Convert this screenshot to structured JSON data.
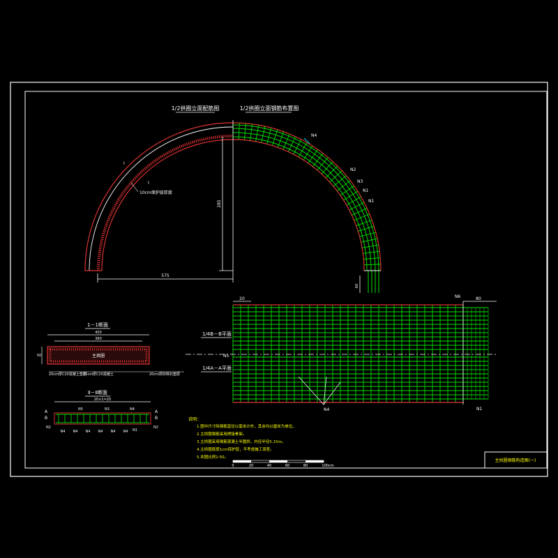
{
  "titles": {
    "left_half": "1/2拱圈立面配筋图",
    "right_half": "1/2拱圈立面钢筋布置图",
    "sec_1": "1－1断面",
    "sec_2": "Ⅱ－Ⅱ断面",
    "plan_b": "1/4B－B平面",
    "plan_a": "1/4A－A平面"
  },
  "labels": {
    "layer_10cm": "10cm保护层厚度",
    "n1": "N1",
    "n2": "N2",
    "n3": "N3",
    "n4": "N4",
    "n5": "N5",
    "n6": "N6",
    "a": "A",
    "b": "B",
    "i": "I",
    "sec1_center": "主拱圈",
    "sec1_bottom_left": "20cm厚C20混凝土垫层",
    "sec1_bottom_mid": "15cm厚C25混凝土",
    "sec1_bottom_right": "20cm厚砂砾石垫层"
  },
  "dimensions": {
    "radius": "575",
    "height": "285",
    "sec1_total": "450",
    "sec1_inner": "360",
    "sec1_depth": "50",
    "sec2_span": "20×1=20",
    "plan_spacing": "20",
    "plan_end": "80",
    "leg": "60"
  },
  "notes": {
    "header": "说明：",
    "items": [
      "1.图中尺寸除钢筋直径以毫米计外，其余均以厘米为单位。",
      "2.主拱圈钢筋采用焊接骨架。",
      "3.主拱圈采用钢筋混凝土半圆拱，内径半径5.15m。",
      "4.主拱圈厚度1cm保护层，不考虑施工误差。",
      "5.本图比例1:50。"
    ]
  },
  "scale_bar": {
    "ticks": [
      "0",
      "20",
      "40",
      "60",
      "80",
      "100cm"
    ]
  },
  "title_block": {
    "drawing_name": "主拱圈钢筋构造图(一)"
  },
  "colors": {
    "background": "#000000",
    "frame": "#ffffff",
    "concrete": "#e03232",
    "rebar": "#00e000",
    "text": "#ffff00",
    "leader": "#00d8ff"
  }
}
